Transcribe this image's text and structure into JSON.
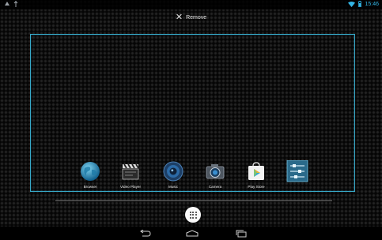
{
  "status_bar": {
    "left_icons": [
      "android-icon",
      "usb-icon"
    ],
    "right_icons": [
      "wifi-icon",
      "battery-icon"
    ],
    "time": "15:46"
  },
  "remove_bar": {
    "label": "Remove"
  },
  "dock": [
    {
      "label": "Browser",
      "icon": "globe-icon"
    },
    {
      "label": "Video Player",
      "icon": "clapperboard-icon"
    },
    {
      "label": "Music",
      "icon": "speaker-icon"
    },
    {
      "label": "Camera",
      "icon": "camera-icon"
    },
    {
      "label": "Play Store",
      "icon": "play-store-icon"
    },
    {
      "label": "",
      "icon": "settings-sliders-icon"
    }
  ],
  "navigation": [
    "back-icon",
    "home-icon",
    "recent-apps-icon"
  ],
  "colors": {
    "accent": "#33b5e5",
    "frame": "#37a9c8",
    "background": "#0b0b0b"
  }
}
